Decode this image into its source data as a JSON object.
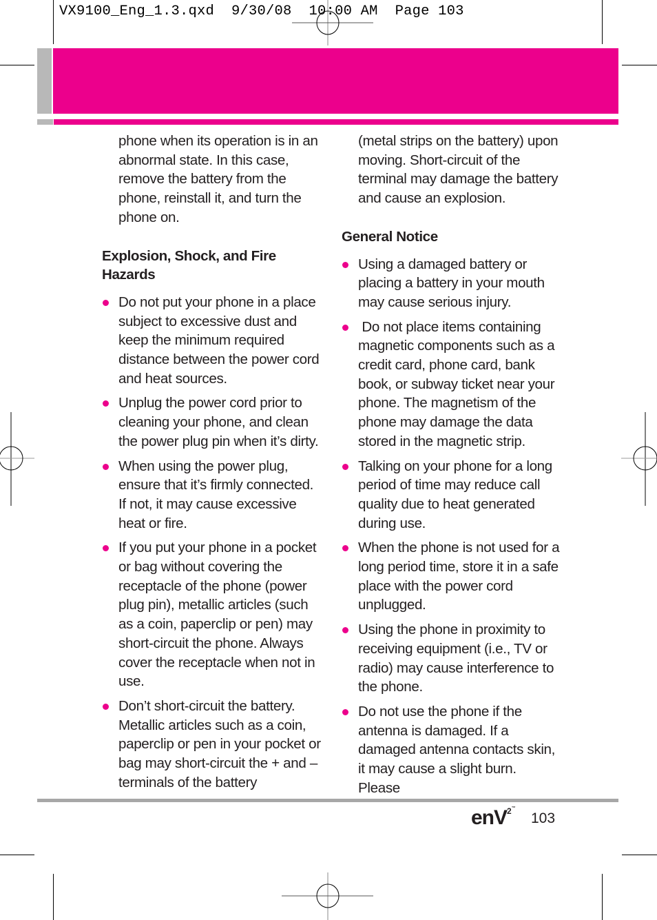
{
  "slug_line": "VX9100_Eng_1.3.qxd  9/30/08  10:00 AM  Page 103",
  "colors": {
    "accent": "#ec008c",
    "tab_gray": "#b8b8b8",
    "rule_gray": "#a7a7a7"
  },
  "left_column": {
    "continuation": "phone when its operation is in an abnormal state. In this case, remove the battery from the phone, reinstall it, and turn the phone on.",
    "heading": "Explosion, Shock, and Fire Hazards",
    "bullets": [
      "Do not put your phone in a place subject to excessive dust and keep the minimum required distance between the power cord and heat sources.",
      "Unplug the power cord prior to cleaning your phone, and clean the power plug pin when it’s dirty.",
      "When using the power plug, ensure that it’s firmly connected. If not, it may cause excessive heat or fire.",
      "If you put your phone in a pocket or bag without covering the receptacle of the phone (power plug pin), metallic articles (such as a coin, paperclip or pen) may short-circuit the phone. Always cover the receptacle when not in use.",
      "Don’t short-circuit the battery. Metallic articles such as a coin, paperclip or pen in your pocket or bag may short-circuit the + and – terminals of the battery"
    ]
  },
  "right_column": {
    "continuation": "(metal strips on the battery) upon moving. Short-circuit of the terminal may damage the battery and cause an explosion.",
    "heading": "General Notice",
    "bullets": [
      "Using a damaged battery or placing a battery in your mouth may cause serious injury.",
      " Do not place items containing magnetic components such as a credit card, phone card, bank book, or subway ticket near your phone. The magnetism of the phone may damage the data stored in the magnetic strip.",
      "Talking on your phone for a long period of time may reduce call quality due to heat generated during use.",
      "When the phone is not used for a long period time, store it in a safe place with the power cord unplugged.",
      "Using the phone in proximity to receiving equipment (i.e., TV or radio) may cause interference to the phone.",
      "Do not use the phone if the antenna is damaged. If a damaged antenna contacts skin, it may cause a slight burn. Please"
    ]
  },
  "footer": {
    "logo_text": "enV",
    "logo_superscript": "2",
    "logo_tm": "™",
    "page_number": "103"
  }
}
